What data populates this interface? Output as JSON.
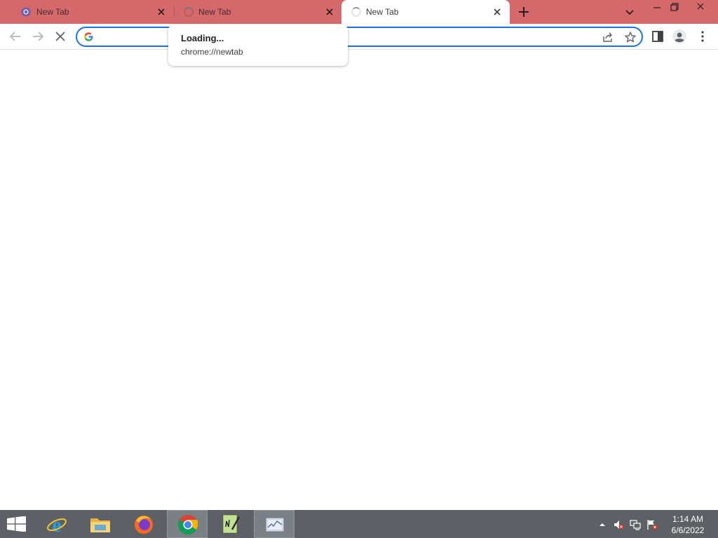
{
  "browser": {
    "tabs": [
      {
        "label": "New Tab",
        "state": "inactive",
        "icon": "chrome-favicon-icon"
      },
      {
        "label": "New Tab",
        "state": "inactive",
        "icon": "loading-spinner-icon"
      },
      {
        "label": "New Tab",
        "state": "active",
        "icon": "loading-spinner-icon"
      }
    ],
    "omnibox": {
      "value": "",
      "placeholder": ""
    },
    "hovercard": {
      "title": "Loading...",
      "url": "chrome://newtab"
    }
  },
  "taskbar": {
    "apps": [
      "start-menu",
      "internet-explorer",
      "file-explorer",
      "firefox",
      "chrome",
      "notepad-plus",
      "task-manager"
    ],
    "clock": {
      "time": "1:14 AM",
      "date": "6/6/2022"
    }
  },
  "colors": {
    "tabstrip": "#d3696a",
    "accent": "#1a73e8",
    "taskbar": "#5d6166"
  }
}
